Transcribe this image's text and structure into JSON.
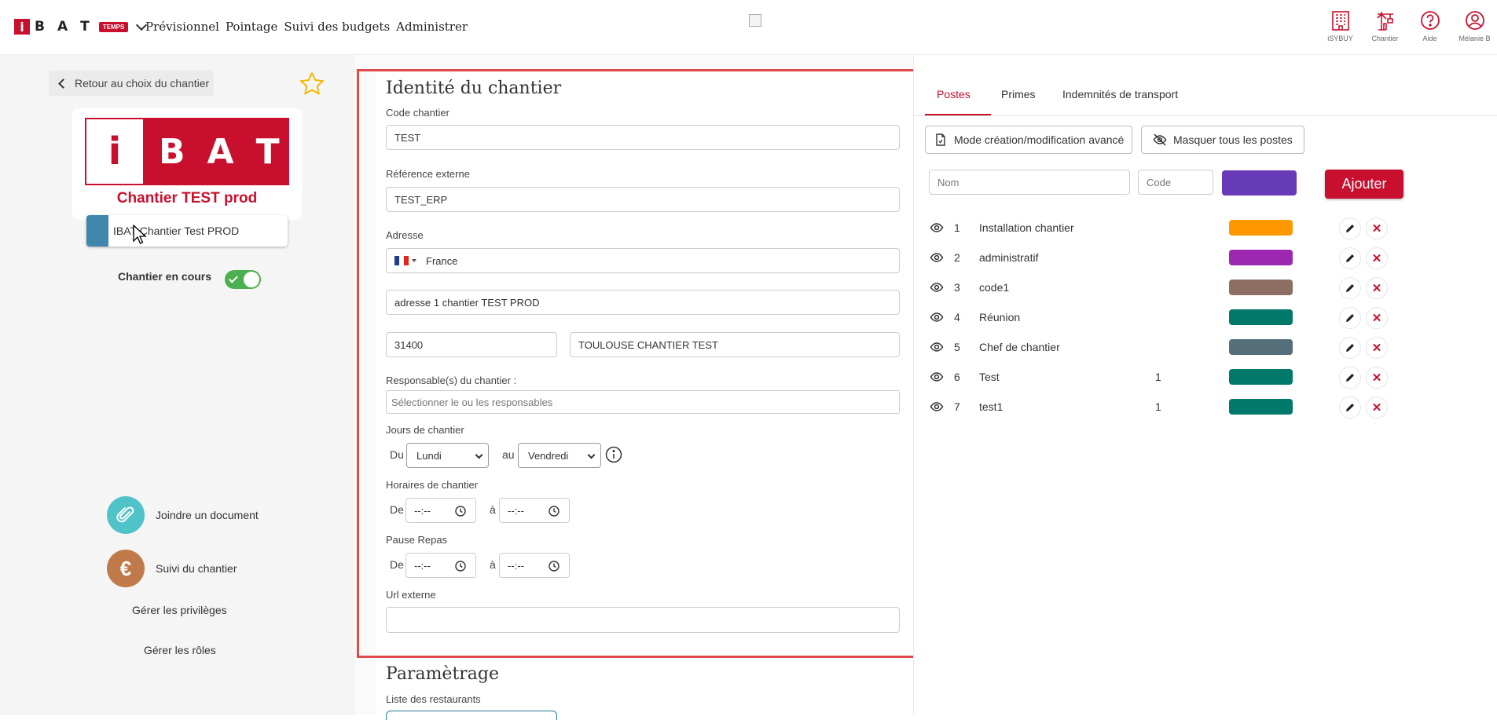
{
  "topbar": {
    "logo_letters": [
      "i",
      "B",
      "A",
      "T"
    ],
    "logo_tag": "TEMPS",
    "nav": [
      "Prévisionnel",
      "Pointage",
      "Suivi des budgets",
      "Administrer"
    ],
    "icons": [
      {
        "name": "isybuy-icon",
        "label": "iSYBUY"
      },
      {
        "name": "chantier-icon",
        "label": "Chantier"
      },
      {
        "name": "help-icon",
        "label": "Aide"
      },
      {
        "name": "user-icon",
        "label": "Mélanie B"
      }
    ]
  },
  "left": {
    "back_label": "Retour au choix du chantier",
    "logo_letters": [
      "i",
      "B",
      "A",
      "T"
    ],
    "logo_caption": "Chantier TEST prod",
    "site_name": "IBAT Chantier Test PROD",
    "site_color": "#3f86ad",
    "status_label": "Chantier en cours",
    "status_on": true,
    "attach_label": "Joindre un document",
    "follow_label": "Suivi du chantier",
    "follow_symbol": "€",
    "privileges_label": "Gérer les privilèges",
    "roles_label": "Gérer les rôles"
  },
  "form": {
    "title": "Identité du chantier",
    "code_label": "Code chantier",
    "code_value": "TEST",
    "ref_label": "Référence externe",
    "ref_value": "TEST_ERP",
    "address_label": "Adresse",
    "country": "France",
    "address_line": "adresse 1 chantier TEST PROD",
    "postal_code": "31400",
    "city": "TOULOUSE CHANTIER TEST",
    "managers_label": "Responsable(s) du chantier :",
    "managers_placeholder": "Sélectionner le ou les responsables",
    "days_label": "Jours de chantier",
    "days_from_prefix": "Du",
    "days_from": "Lundi",
    "days_to_prefix": "au",
    "days_to": "Vendredi",
    "hours_label": "Horaires de chantier",
    "from_prefix": "De",
    "to_prefix": "à",
    "time_placeholder": "--:--",
    "lunch_label": "Pause Repas",
    "url_label": "Url externe",
    "url_value": "",
    "settings_title": "Paramètrage",
    "restaurants_label": "Liste des restaurants"
  },
  "right": {
    "tabs": [
      "Postes",
      "Primes",
      "Indemnités de transport"
    ],
    "active_tab": "Postes",
    "advanced_btn": "Mode création/modification avancé",
    "hide_btn": "Masquer tous les postes",
    "name_placeholder": "Nom",
    "code_placeholder": "Code",
    "new_color": "#673ab7",
    "add_label": "Ajouter",
    "delete_symbol": "✕",
    "postes": [
      {
        "num": "1",
        "name": "Installation chantier",
        "code": "",
        "color": "#ff9800"
      },
      {
        "num": "2",
        "name": "administratif",
        "code": "",
        "color": "#9c27b0"
      },
      {
        "num": "3",
        "name": "code1",
        "code": "",
        "color": "#8d6e63"
      },
      {
        "num": "4",
        "name": "Réunion",
        "code": "",
        "color": "#00796b"
      },
      {
        "num": "5",
        "name": "Chef de chantier",
        "code": "",
        "color": "#546e7a"
      },
      {
        "num": "6",
        "name": "Test",
        "code": "1",
        "color": "#00796b"
      },
      {
        "num": "7",
        "name": "test1",
        "code": "1",
        "color": "#00796b"
      }
    ]
  }
}
